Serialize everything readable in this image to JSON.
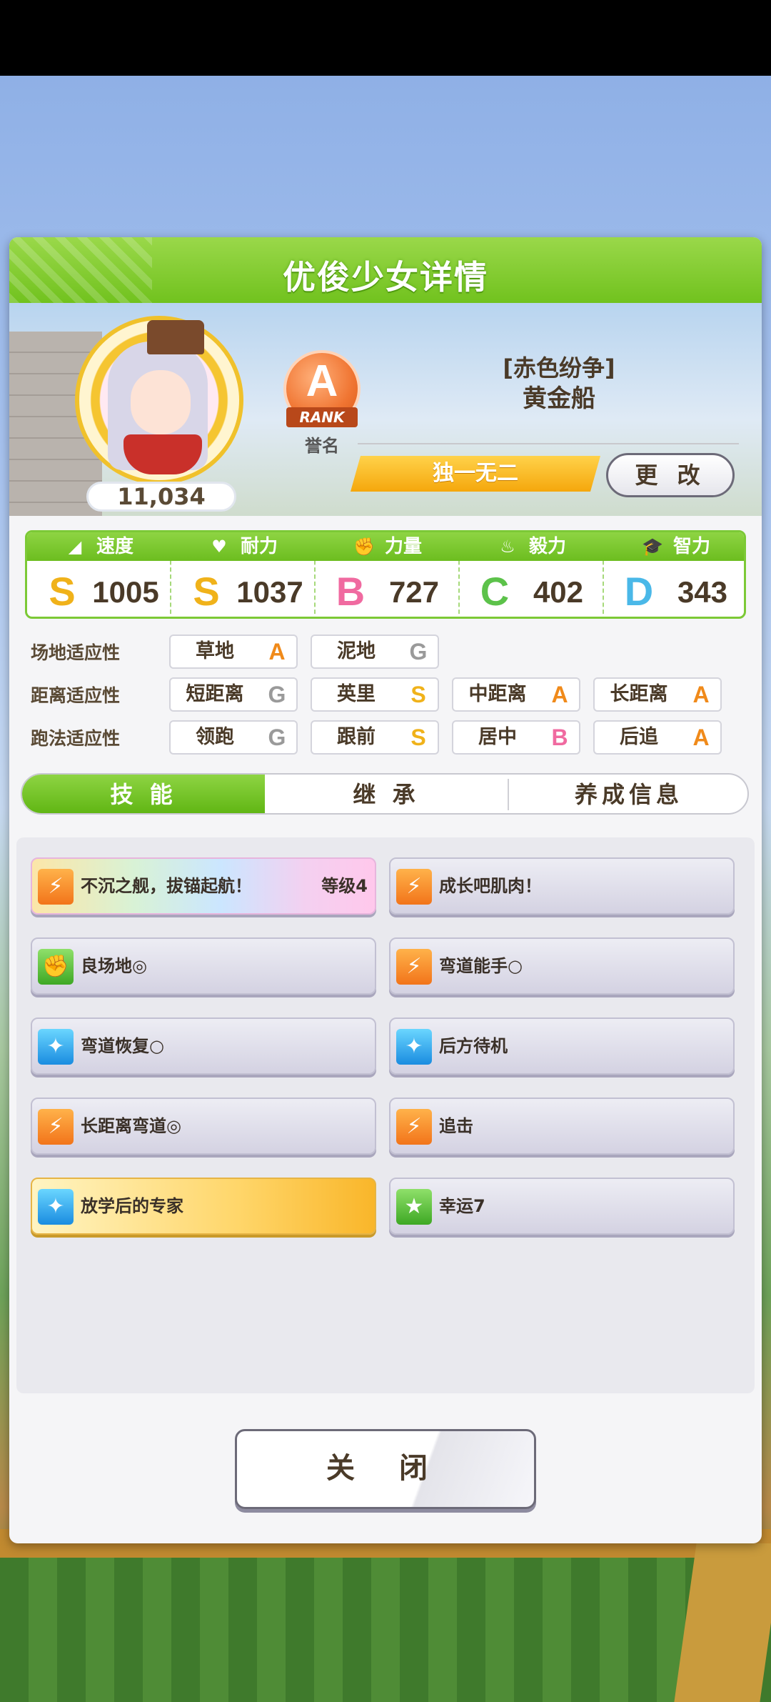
{
  "header": {
    "title": "优俊少女详情"
  },
  "profile": {
    "score": "11,034",
    "rank_letter": "A",
    "rank_word": "RANK",
    "rank_label": "誉名",
    "outfit_title": "[赤色纷争]",
    "name": "黄金船",
    "epithet": "独一无二",
    "change_label": "更 改"
  },
  "stats": [
    {
      "label": "速度",
      "icon": "shoe-icon",
      "glyph": "◢",
      "grade": "S",
      "value": "1005",
      "color": "#f0b21a"
    },
    {
      "label": "耐力",
      "icon": "heart-icon",
      "glyph": "♥",
      "grade": "S",
      "value": "1037",
      "color": "#f0b21a"
    },
    {
      "label": "力量",
      "icon": "muscle-icon",
      "glyph": "✊",
      "grade": "B",
      "value": "727",
      "color": "#f06aa0"
    },
    {
      "label": "毅力",
      "icon": "flame-icon",
      "glyph": "♨",
      "grade": "C",
      "value": "402",
      "color": "#5cc24a"
    },
    {
      "label": "智力",
      "icon": "graduation-cap-icon",
      "glyph": "🎓",
      "grade": "D",
      "value": "343",
      "color": "#4ab8e8"
    }
  ],
  "aptitude": {
    "track": {
      "label": "场地适应性",
      "items": [
        {
          "name": "草地",
          "grade": "A"
        },
        {
          "name": "泥地",
          "grade": "G"
        }
      ]
    },
    "distance": {
      "label": "距离适应性",
      "items": [
        {
          "name": "短距离",
          "grade": "G"
        },
        {
          "name": "英里",
          "grade": "S"
        },
        {
          "name": "中距离",
          "grade": "A"
        },
        {
          "name": "长距离",
          "grade": "A"
        }
      ]
    },
    "style": {
      "label": "跑法适应性",
      "items": [
        {
          "name": "领跑",
          "grade": "G"
        },
        {
          "name": "跟前",
          "grade": "S"
        },
        {
          "name": "居中",
          "grade": "B"
        },
        {
          "name": "后追",
          "grade": "A"
        }
      ]
    }
  },
  "tabs": [
    {
      "label": "技 能"
    },
    {
      "label": "继 承"
    },
    {
      "label": "养成信息"
    }
  ],
  "skills": [
    {
      "name": "不沉之舰，拔锚起航！",
      "level": "等级4",
      "icon": "running-figure-icon"
    },
    {
      "name": "成长吧肌肉！",
      "icon": "running-figure-icon"
    },
    {
      "name": "良场地◎",
      "icon": "muscle-icon"
    },
    {
      "name": "弯道能手○",
      "icon": "running-figure-icon"
    },
    {
      "name": "弯道恢复○",
      "icon": "sparkle-icon"
    },
    {
      "name": "后方待机",
      "icon": "sparkle-icon"
    },
    {
      "name": "长距离弯道◎",
      "icon": "running-figure-icon"
    },
    {
      "name": "追击",
      "icon": "running-figure-icon"
    },
    {
      "name": "放学后的专家",
      "icon": "sparkle-icon"
    },
    {
      "name": "幸运7",
      "icon": "star-figure-icon"
    }
  ],
  "close_label": "关 闭",
  "colors": {
    "accent_green": "#71c21e",
    "gold": "#f5a70c"
  }
}
